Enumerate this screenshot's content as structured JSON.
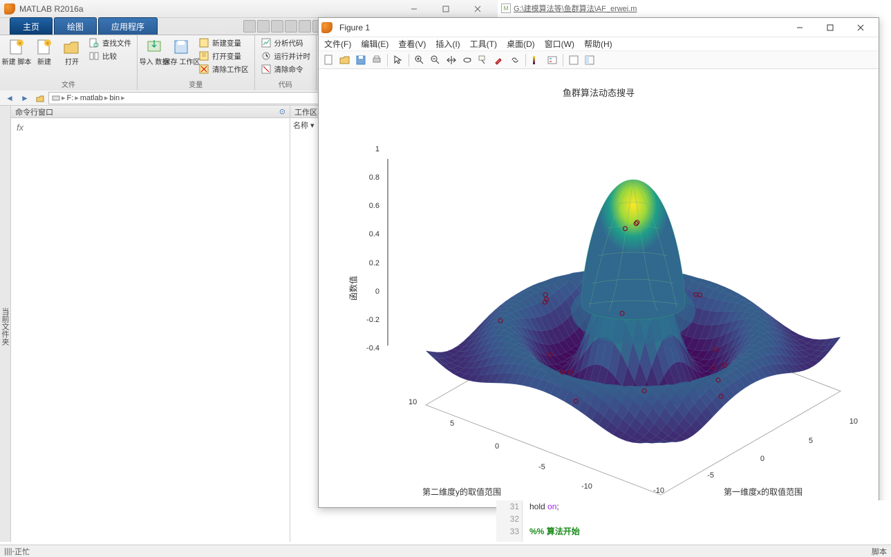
{
  "matlab": {
    "title": "MATLAB R2016a",
    "ribbon": {
      "tabs": [
        "主页",
        "绘图",
        "应用程序"
      ],
      "file_group": "文件",
      "var_group": "变量",
      "code_group": "代码",
      "new_script": "新建\n脚本",
      "new": "新建",
      "open": "打开",
      "find_files": "查找文件",
      "compare": "比较",
      "import": "导入\n数据",
      "save_ws": "保存\n工作区",
      "new_var": "新建变量",
      "open_var": "打开变量",
      "clear_ws": "清除工作区",
      "analyze": "分析代码",
      "run_time": "运行并计时",
      "clear_cmd": "清除命令"
    },
    "address": {
      "drive": "F:",
      "p1": "matlab",
      "p2": "bin"
    },
    "cmd_panel": "命令行窗口",
    "workspace_panel": "工作区",
    "name_col": "名称",
    "side_tab": "当前文件夹",
    "prompt": "fx",
    "status_left": "正忙",
    "status_right": "脚本"
  },
  "editor_tab": "G:\\建模算法等\\鱼群算法\\AF_erwei.m",
  "code_peek": {
    "l31": "31",
    "l32": "32",
    "l33": "33",
    "c31a": "hold ",
    "c31b": "on",
    "c31c": ";",
    "c33a": "%% ",
    "c33b": "算法开始"
  },
  "figure": {
    "title": "Figure 1",
    "menus": [
      "文件(F)",
      "编辑(E)",
      "查看(V)",
      "插入(I)",
      "工具(T)",
      "桌面(D)",
      "窗口(W)",
      "帮助(H)"
    ]
  },
  "chart_data": {
    "type": "surface3d",
    "title": "鱼群算法动态搜寻",
    "xlabel": "第一维度x的取值范围",
    "ylabel": "第二维度y的取值范围",
    "zlabel": "函数值",
    "x_range": [
      -10,
      10
    ],
    "y_range": [
      -10,
      10
    ],
    "z_range": [
      -0.4,
      1
    ],
    "x_ticks": [
      -10,
      -5,
      0,
      5,
      10
    ],
    "y_ticks": [
      -10,
      -5,
      0,
      5,
      10
    ],
    "z_ticks": [
      -0.4,
      -0.2,
      0,
      0.2,
      0.4,
      0.6,
      0.8,
      1
    ],
    "function_hint": "sinc-like peak surface, z≈sinc(r) with r=sqrt(x²+y²), main peak≈1 at origin, side lobes≈-0.2..0.1",
    "scatter_points_approx": [
      {
        "x": 0.4,
        "y": 0.2,
        "z": 0.95
      },
      {
        "x": -0.3,
        "y": 0.5,
        "z": 0.9
      },
      {
        "x": 0.1,
        "y": -0.3,
        "z": 0.93
      },
      {
        "x": 7.2,
        "y": 0.5,
        "z": 0.1
      },
      {
        "x": 7.5,
        "y": -0.4,
        "z": 0.09
      },
      {
        "x": 8,
        "y": 1,
        "z": 0.05
      },
      {
        "x": -7.2,
        "y": 0.4,
        "z": 0.1
      },
      {
        "x": -7.6,
        "y": -0.3,
        "z": 0.08
      },
      {
        "x": 0.3,
        "y": 7.4,
        "z": 0.1
      },
      {
        "x": -0.2,
        "y": 7.6,
        "z": 0.09
      },
      {
        "x": 0.1,
        "y": -7.3,
        "z": 0.1
      },
      {
        "x": -0.4,
        "y": -7.5,
        "z": 0.08
      },
      {
        "x": 4,
        "y": 4,
        "z": -0.05
      },
      {
        "x": -4,
        "y": 4,
        "z": -0.05
      },
      {
        "x": 4,
        "y": -4,
        "z": -0.05
      },
      {
        "x": -4,
        "y": -4,
        "z": -0.05
      },
      {
        "x": -9,
        "y": -2,
        "z": 0
      },
      {
        "x": -9,
        "y": 3,
        "z": 0
      },
      {
        "x": 9,
        "y": 2,
        "z": 0
      },
      {
        "x": 2,
        "y": 9,
        "z": 0
      }
    ]
  }
}
